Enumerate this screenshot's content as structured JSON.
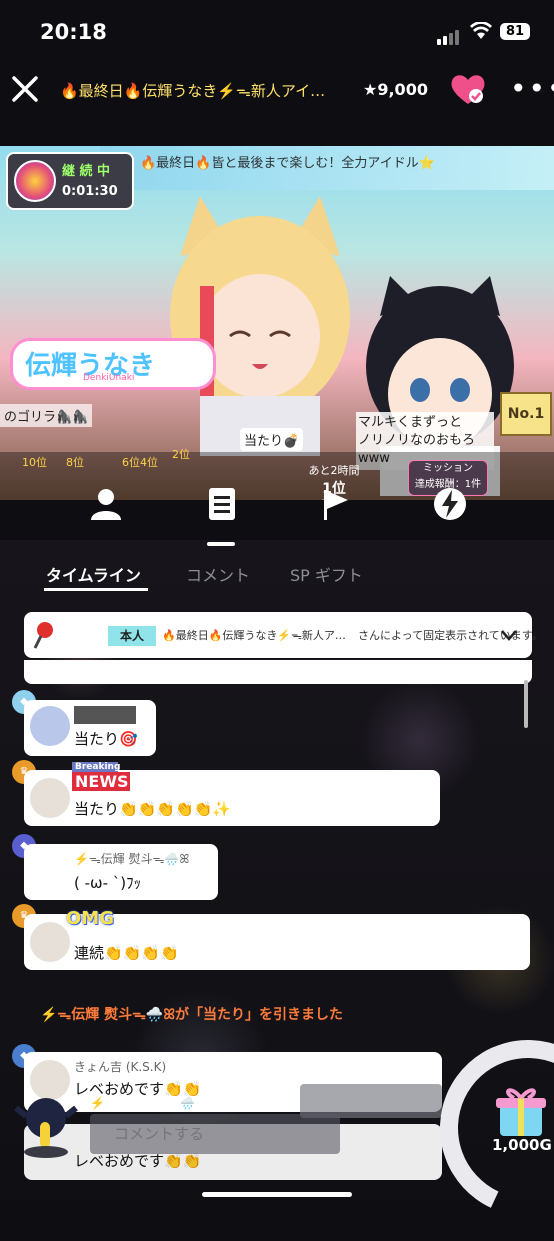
{
  "status_bar": {
    "time": "20:18",
    "battery": "81"
  },
  "header": {
    "title": "🔥最終日🔥伝輝うなき⚡️ᯓ新人アイ…",
    "star_count": "★9,000"
  },
  "stream": {
    "onair_label": "継 続 中",
    "onair_time": "0:01:30",
    "banner": "🔥最終日🔥皆と最後まで楽しむ！全力アイドル⭐",
    "logo_text": "伝輝うなき",
    "logo_sub": "DenkiUnaki",
    "gorilla_text": "のゴリラ🦍🦍",
    "comment_box": "マルキくまずっと\nノリノリなのおもろwww",
    "no1": "No.1",
    "hit_bubble": "当たり💣",
    "remain_label": "あと2時間",
    "rank_level": "1位 2Lv",
    "mission_title": "ミッション",
    "mission_sub": "達成報酬：1件",
    "rank_labels": [
      "10位",
      "8位",
      "6位",
      "4位",
      "2位"
    ]
  },
  "tabs": [
    {
      "label": "タイムライン",
      "active": true
    },
    {
      "label": "コメント",
      "active": false
    },
    {
      "label": "SP ギフト",
      "active": false
    }
  ],
  "pinned": {
    "badge": "本人",
    "title": "🔥最終日🔥伝輝うなき⚡️ᯓ新人ア…",
    "suffix": "さんによって固定表示されています。"
  },
  "comments": [
    {
      "text": "当たり🎯",
      "level": ""
    },
    {
      "badge_top": "Breaking",
      "badge_main": "NEWS",
      "text": "当たり👏👏👏👏👏✨"
    },
    {
      "name": "⚡️ᯓ伝輝 熨斗ᯓ🌧️ꕤ",
      "text": "( -ω- `)ﾌｯ"
    },
    {
      "badge": "OMG",
      "text": "連続👏👏👏👏"
    },
    {
      "name": "きょん吉 (K.S.K)",
      "text": "レベおめです👏👏"
    },
    {
      "text": "レベおめです👏👏"
    }
  ],
  "system_message": "⚡️ᯓ伝輝 熨斗ᯓ🌧️ꕤが「当たり」を引きました",
  "bottom": {
    "mini_user": "⚡️ᯓ伝輝 熨斗ᯓ🌧️ꕤ",
    "input_placeholder": "コメントする",
    "gift_amount": "1,000G"
  },
  "colors": {
    "accent_pink": "#f0508a",
    "system_orange": "#ff7b3a",
    "pinned_badge": "#8fe3e9"
  },
  "icons": [
    "close-icon",
    "heart-icon",
    "more-icon",
    "user-icon",
    "document-icon",
    "flag-icon",
    "lightning-icon",
    "pin-icon",
    "chevron-down-icon",
    "gift-icon"
  ]
}
